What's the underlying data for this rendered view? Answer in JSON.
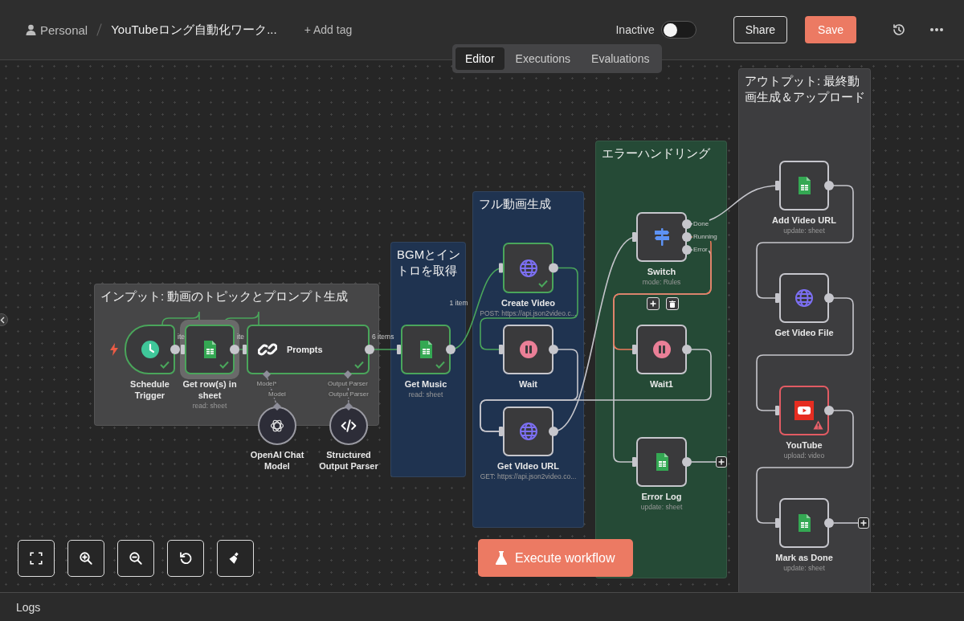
{
  "header": {
    "owner": "Personal",
    "workflow_title": "YouTubeロング自動化ワーク...",
    "add_tag": "+ Add tag",
    "status_label": "Inactive",
    "active": false,
    "share_button": "Share",
    "save_button": "Save"
  },
  "view_tabs": [
    {
      "label": "Editor",
      "selected": true
    },
    {
      "label": "Executions",
      "selected": false
    },
    {
      "label": "Evaluations",
      "selected": false
    }
  ],
  "canvas": {
    "groups": [
      {
        "title": "インプット: 動画のトピックとプロンプト生成",
        "color": "#464647"
      },
      {
        "title": "BGMとイントロを取得",
        "color": "#1f3350"
      },
      {
        "title": "フル動画生成",
        "color": "#1f3350"
      },
      {
        "title": "エラーハンドリング",
        "color": "#254a36"
      },
      {
        "title": "アウトプット: 最終動画生成＆アップロード",
        "color": "#3d3d3f"
      }
    ],
    "nodes": [
      {
        "name": "Schedule Trigger",
        "kind": "trigger",
        "executed": true,
        "warning": false,
        "selected": false
      },
      {
        "name": "Get row(s) in sheet",
        "subtitle": "read: sheet",
        "kind": "regular",
        "executed": true,
        "warning": false,
        "selected": true
      },
      {
        "name": "Prompts",
        "kind": "wide",
        "executed": true,
        "warning": false,
        "selected": false,
        "inputs_below": [
          "Model*",
          "Output Parser"
        ]
      },
      {
        "name": "OpenAI Chat Model",
        "kind": "sub",
        "executed": false,
        "warning": false,
        "selected": false,
        "port_label": "Model"
      },
      {
        "name": "Structured Output Parser",
        "kind": "sub",
        "executed": false,
        "warning": false,
        "selected": false,
        "port_label": "Output Parser"
      },
      {
        "name": "Get Music",
        "subtitle": "read: sheet",
        "kind": "regular",
        "executed": true,
        "warning": false,
        "selected": false
      },
      {
        "name": "Create Video",
        "subtitle": "POST: https://api.json2video.c...",
        "kind": "regular",
        "executed": true,
        "warning": false,
        "selected": false
      },
      {
        "name": "Wait",
        "kind": "regular",
        "executed": false,
        "warning": false,
        "selected": false
      },
      {
        "name": "Get VIdeo URL",
        "subtitle": "GET: https://api.json2video.co...",
        "kind": "regular",
        "executed": false,
        "warning": false,
        "selected": false
      },
      {
        "name": "Switch",
        "subtitle": "mode: Rules",
        "kind": "regular",
        "executed": false,
        "warning": false,
        "selected": false,
        "outputs": [
          "Done",
          "Running",
          "Error"
        ]
      },
      {
        "name": "Wait1",
        "kind": "regular",
        "executed": false,
        "warning": false,
        "selected": false
      },
      {
        "name": "Error Log",
        "subtitle": "update: sheet",
        "kind": "regular",
        "executed": false,
        "warning": false,
        "selected": false,
        "add_button": true
      },
      {
        "name": "Add Video URL",
        "subtitle": "update: sheet",
        "kind": "regular",
        "executed": false,
        "warning": false,
        "selected": false
      },
      {
        "name": "Get Video File",
        "kind": "regular",
        "executed": false,
        "warning": false,
        "selected": false
      },
      {
        "name": "YouTube",
        "subtitle": "upload: video",
        "kind": "regular",
        "executed": false,
        "warning": true,
        "selected": false
      },
      {
        "name": "Mark as Done",
        "subtitle": "update: sheet",
        "kind": "regular",
        "executed": false,
        "warning": false,
        "selected": false,
        "add_button": true
      }
    ],
    "connections": [
      {
        "highlighted": false,
        "label": "ite"
      },
      {
        "highlighted": false,
        "label": "ite"
      },
      {
        "highlighted": false
      },
      {
        "highlighted": false
      },
      {
        "highlighted": false,
        "label": "6 items"
      },
      {
        "highlighted": false,
        "label": "1 item"
      },
      {
        "highlighted": false
      },
      {
        "highlighted": false
      },
      {
        "highlighted": false
      },
      {
        "highlighted": false
      },
      {
        "highlighted": false
      },
      {
        "highlighted": true
      },
      {
        "highlighted": false
      },
      {
        "highlighted": false
      },
      {
        "highlighted": false
      },
      {
        "highlighted": false
      }
    ]
  },
  "execute_button": "Execute workflow",
  "logs_panel": {
    "title": "Logs"
  }
}
